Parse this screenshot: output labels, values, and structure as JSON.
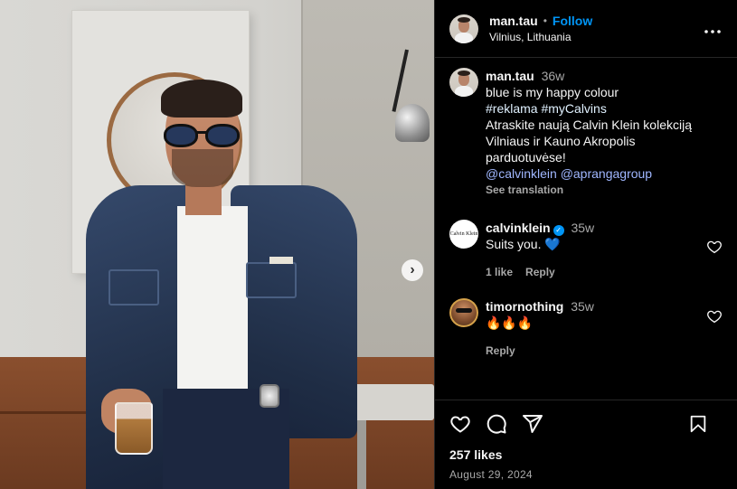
{
  "post": {
    "author": {
      "username": "man.tau",
      "follow_label": "Follow",
      "location": "Vilnius, Lithuania",
      "dot": "•",
      "more_icon": "more-horizontal-icon"
    },
    "photo": {
      "next_icon": "chevron-right-icon",
      "next_glyph": "›"
    },
    "caption": {
      "username": "man.tau",
      "time": "36w",
      "line1": "blue is my happy colour",
      "hashtags": "#reklama #myCalvins",
      "line2": "Atraskite naują Calvin Klein kolekciją Vilniaus ir Kauno Akropolis parduotuvėse!",
      "mentions": "@calvinklein @aprangagroup",
      "see_translation": "See translation"
    },
    "comments": [
      {
        "username": "calvinklein",
        "verified": true,
        "verified_glyph": "✓",
        "avatar_text": "Calvin Klein",
        "time": "35w",
        "text": "Suits you. 💙",
        "likes_label": "1 like",
        "reply_label": "Reply"
      },
      {
        "username": "timornothing",
        "verified": false,
        "time": "35w",
        "text": "🔥🔥🔥",
        "reply_label": "Reply"
      }
    ],
    "actions": {
      "icons": [
        "heart-icon",
        "comment-icon",
        "share-icon",
        "bookmark-icon"
      ],
      "likes": "257 likes",
      "date": "August 29, 2024"
    }
  },
  "colors": {
    "background": "#000000",
    "accent": "#0095f6",
    "mention": "#a0b7ff",
    "muted": "#a8a8a8",
    "divider": "#262626"
  }
}
